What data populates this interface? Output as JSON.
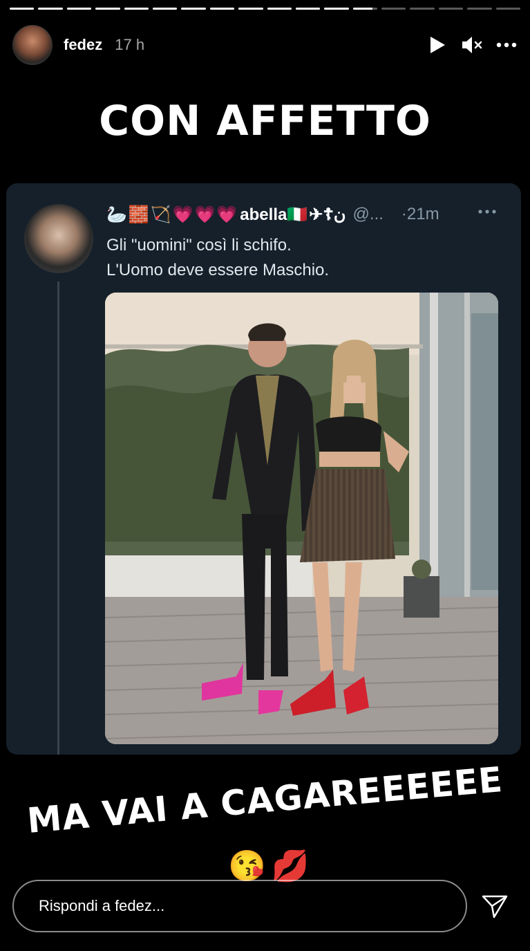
{
  "story": {
    "segments_total": 18,
    "segments_viewed": 13,
    "current_segment_progress": 0.8
  },
  "header": {
    "username": "fedez",
    "timestamp": "17 h",
    "icons": [
      "play-icon",
      "mute-icon",
      "more-icon"
    ]
  },
  "captions": {
    "top": "CON AFFETTO",
    "bottom": "MA VAI A CAGAREEEEEE"
  },
  "tweet": {
    "name_emojis": "🦢🧱🏹💗💗💗",
    "display_name": "abella🇮🇹",
    "name_suffix": " ✈☦ن",
    "handle": "@...",
    "time": "·21m",
    "lines": [
      "Gli \"uomini\" così li schifo.",
      "L'Uomo deve essere Maschio."
    ]
  },
  "reactions": [
    "😘",
    "💋"
  ],
  "reply": {
    "placeholder": "Rispondi a fedez..."
  },
  "colors": {
    "background": "#000000",
    "tweet_card": "#15202b",
    "secondary_text": "#8899a6"
  }
}
